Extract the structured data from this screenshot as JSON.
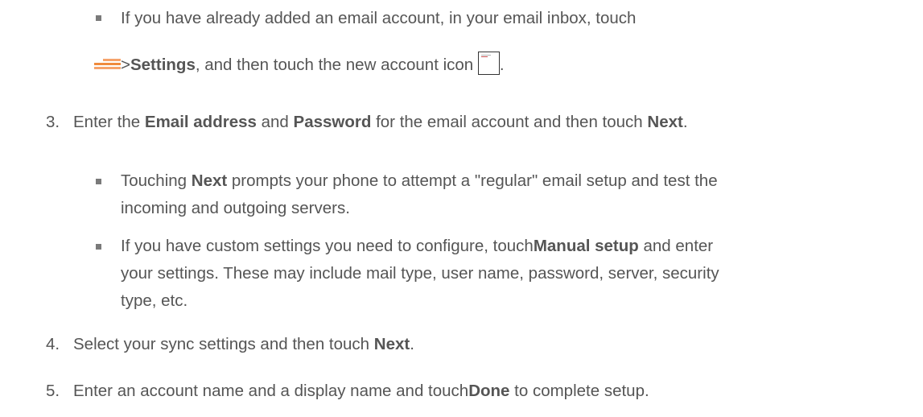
{
  "step2_sub": {
    "line1": "If you have already added an email account, in your email inbox, touch",
    "sep": ">",
    "settings": "Settings",
    "mid": ", and then touch the new account icon",
    "end": "."
  },
  "step3": {
    "number": "3.",
    "t1": "Enter the ",
    "email_address": "Email address",
    "t2": " and ",
    "password": "Password",
    "t3": " for the email account and then touch ",
    "next": "Next",
    "t4": ".",
    "sub1": {
      "t1": "Touching ",
      "next": "Next",
      "t2": " prompts your phone to attempt a \"regular\" email setup and test the",
      "line2": "incoming and outgoing servers."
    },
    "sub2": {
      "t1": "If you have custom settings you need to configure, touch",
      "manual_setup": "Manual setup",
      "t2": " and enter",
      "line2": "your settings. These may include mail type, user name, password, server, security",
      "line3": "type, etc."
    }
  },
  "step4": {
    "number": "4.",
    "t1": "Select your sync settings and then touch ",
    "next": "Next",
    "t2": "."
  },
  "step5": {
    "number": "5.",
    "t1": "Enter an account name and a display name and touch",
    "done": "Done",
    "t2": " to complete setup."
  },
  "icons": {
    "menu": "menu-icon",
    "new_account": "new-account-icon"
  },
  "colors": {
    "text": "#555555",
    "menu_icon": "#f08a3c"
  }
}
